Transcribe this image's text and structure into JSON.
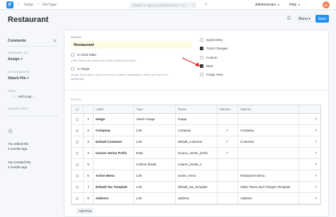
{
  "nav": {
    "logo": "F",
    "crumb1": "Setup",
    "crumb2": "DocType",
    "search_placeholder": "Search or type a command (Ctrl + G)",
    "user": "Administrator",
    "help": "Help",
    "avatar_initials": "ST"
  },
  "page": {
    "title": "Restaurant",
    "menu_label": "Menu",
    "save_label": "Save"
  },
  "sidebar": {
    "comments_label": "Comments",
    "comments_count": "0",
    "assigned_to": "ASSIGNED TO",
    "assign": "Assign",
    "attachments": "ATTACHMENTS",
    "attach_file": "Attach File",
    "tags": "TAGS",
    "add_tag": "Add a tag ...",
    "shared_with": "SHARED WITH",
    "edited_text": "You edited this",
    "edited_time": "4 months ago",
    "created_text": "You created this",
    "created_time": "4 months ago"
  },
  "form": {
    "module_label": "Module",
    "module_value": "Restaurant",
    "is_child_table": "Is Child Table",
    "child_help": "Child Tables are shown as a Grid in other DocTypes.",
    "is_single": "Is Single",
    "single_help_1": "Single Types have only one record no tables associated. Values are stored in",
    "single_help_2": "tabSingles",
    "quick_entry": "Quick Entry",
    "track_changes": "Track Changes",
    "custom": "Custom",
    "beta": "Beta",
    "image_view": "Image View",
    "fields_label": "FIELDS"
  },
  "table": {
    "headers": [
      "",
      "Label",
      "Type",
      "Name",
      "Manda...",
      "Options"
    ],
    "rows": [
      {
        "n": "1",
        "label": "Image",
        "type": "Attach Image",
        "name": "image",
        "mandatory": false,
        "options": ""
      },
      {
        "n": "2",
        "label": "Company",
        "type": "Link",
        "name": "company",
        "mandatory": true,
        "options": "Company"
      },
      {
        "n": "3",
        "label": "Default Customer",
        "type": "Link",
        "name": "default_customer",
        "mandatory": true,
        "options": "Customer"
      },
      {
        "n": "4",
        "label": "Invoice Series Prefix",
        "type": "Data",
        "name": "invoice_series_prefix",
        "mandatory": true,
        "options": ""
      },
      {
        "n": "5",
        "label": "",
        "type": "Column Break",
        "name": "column_break_4",
        "mandatory": false,
        "options": ""
      },
      {
        "n": "6",
        "label": "Active Menu",
        "type": "Link",
        "name": "active_menu",
        "mandatory": false,
        "options": "Restaurant Menu"
      },
      {
        "n": "7",
        "label": "Default Tax Template",
        "type": "Link",
        "name": "default_tax_template",
        "mandatory": false,
        "options": "Sales Taxes and Charges Template"
      },
      {
        "n": "8",
        "label": "Address",
        "type": "Link",
        "name": "address",
        "mandatory": false,
        "options": "Address"
      }
    ],
    "add_row": "Add Row"
  },
  "colors": {
    "primary": "#2490ef",
    "arrow": "#e02424",
    "avatar": "#f0805a"
  },
  "icons": [
    "logo-icon",
    "search-icon",
    "bell-icon",
    "printer-icon",
    "chevron-down-icon",
    "tag-icon",
    "chevron-right-icon",
    "arrow-annotation-icon"
  ]
}
